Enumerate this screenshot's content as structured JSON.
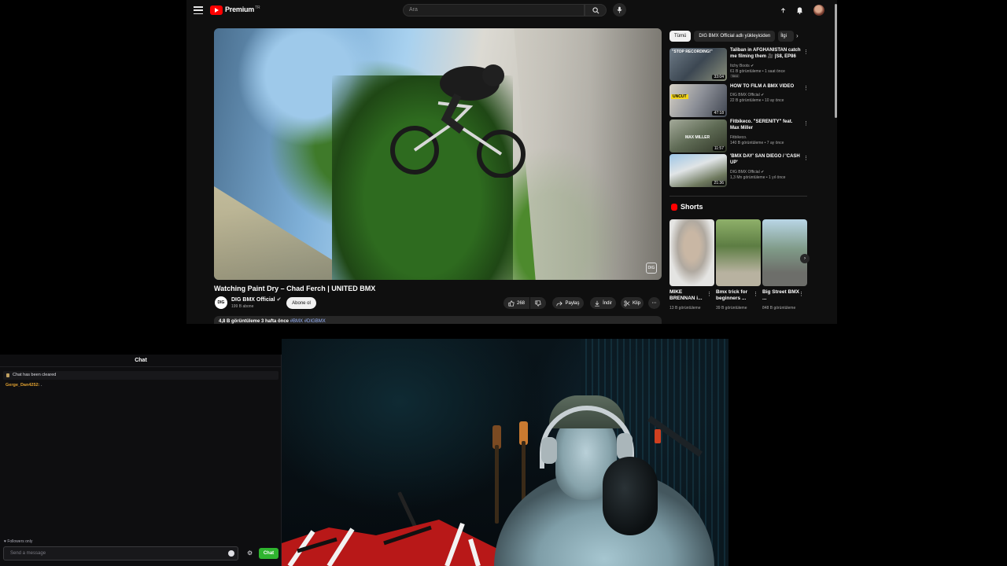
{
  "youtube": {
    "brand": "Premium",
    "brand_sup": "TR",
    "search_placeholder": "Ara",
    "video": {
      "title": "Watching Paint Dry – Chad Ferch | UNITED BMX",
      "channel": "DIG BMX Official",
      "channel_logo": "DIG",
      "subscribers": "199 B abone",
      "subscribe_label": "Abone ol",
      "likes": "268",
      "share_label": "Paylaş",
      "download_label": "İndir",
      "clip_label": "Klip",
      "description_stats": "4,8 B görüntüleme  3 hafta önce",
      "description_tags": "#BMX #DIGBMX",
      "watermark": "DIG"
    },
    "chips": [
      "Tümü",
      "DIG BMX Official adlı yükleyiciden",
      "İlgi"
    ],
    "recommendations": [
      {
        "title": "Taliban in AFGHANISTAN catch me filming them 🎥 |S8, EP86",
        "channel": "Itchy Boots",
        "meta": "61 B görüntüleme • 1 saat önce",
        "duration": "33:04",
        "badge": "Yeni"
      },
      {
        "title": "HOW TO FILM A BMX VIDEO",
        "channel": "DIG BMX Official",
        "meta": "22 B görüntüleme • 10 ay önce",
        "duration": "47:18",
        "badge": ""
      },
      {
        "title": "Fitbikeco. \"SERENITY\" feat. Max Miller",
        "channel": "Fitbikeco.",
        "meta": "140 B görüntüleme • 7 ay önce",
        "duration": "11:57",
        "badge": ""
      },
      {
        "title": "'BMX DAY' SAN DIEGO / 'CASH UP'",
        "channel": "DIG BMX Official",
        "meta": "1,3 Mn görüntüleme • 1 yıl önce",
        "duration": "21:36",
        "badge": ""
      }
    ],
    "shorts_title": "Shorts",
    "shorts": [
      {
        "title": "MIKE BRENNAN i...",
        "views": "13 B görüntüleme"
      },
      {
        "title": "Bmx trick for beginners ...",
        "views": "39 B görüntüleme"
      },
      {
        "title": "Big Street BMX ...",
        "views": "848 B görüntüleme"
      }
    ]
  },
  "chat": {
    "title": "Chat",
    "notice": "Chat has been cleared",
    "messages": [
      {
        "user": "Gerge_Dan4252:",
        "text": "."
      }
    ],
    "mode": "Followers only",
    "input_placeholder": "Send a message",
    "send_label": "Chat"
  },
  "colors": {
    "youtube_red": "#ff0000",
    "chat_send_green": "#2fb52f",
    "username_orange": "#e0a030"
  }
}
